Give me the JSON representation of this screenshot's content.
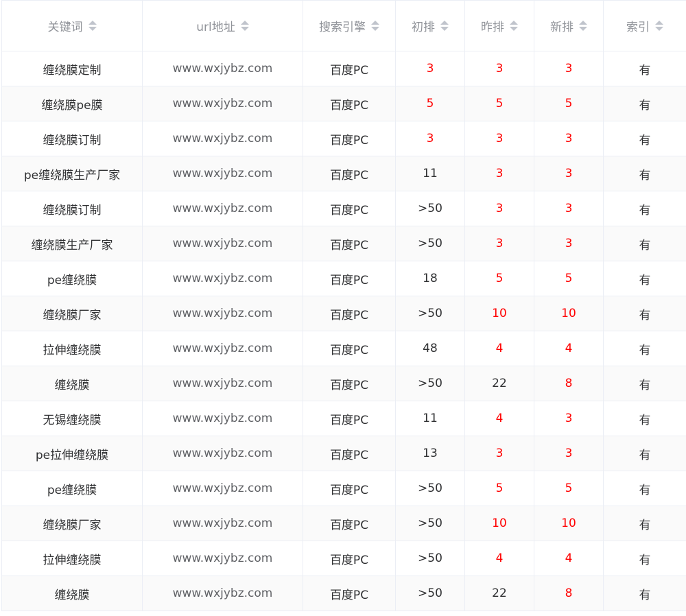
{
  "colors": {
    "rank_highlight": "#ff0000",
    "text": "#303133",
    "header_text": "#909399",
    "border": "#ebeef5",
    "stripe": "#fafafa"
  },
  "columns": [
    {
      "label": "关键词",
      "sort_icon": "sort-caret-icon"
    },
    {
      "label": "url地址",
      "sort_icon": "sort-caret-icon"
    },
    {
      "label": "搜索引擎",
      "sort_icon": "sort-caret-icon"
    },
    {
      "label": "初排",
      "sort_icon": "sort-caret-icon"
    },
    {
      "label": "昨排",
      "sort_icon": "sort-caret-icon"
    },
    {
      "label": "新排",
      "sort_icon": "sort-caret-icon"
    },
    {
      "label": "索引",
      "sort_icon": "sort-caret-icon"
    }
  ],
  "rows": [
    {
      "keyword": "缠绕膜定制",
      "url": "www.wxjybz.com",
      "engine": "百度PC",
      "initial": "3",
      "yesterday": "3",
      "current": "3",
      "index": "有",
      "hi": [
        true,
        true,
        true
      ]
    },
    {
      "keyword": "缠绕膜pe膜",
      "url": "www.wxjybz.com",
      "engine": "百度PC",
      "initial": "5",
      "yesterday": "5",
      "current": "5",
      "index": "有",
      "hi": [
        true,
        true,
        true
      ]
    },
    {
      "keyword": "缠绕膜订制",
      "url": "www.wxjybz.com",
      "engine": "百度PC",
      "initial": "3",
      "yesterday": "3",
      "current": "3",
      "index": "有",
      "hi": [
        true,
        true,
        true
      ]
    },
    {
      "keyword": "pe缠绕膜生产厂家",
      "url": "www.wxjybz.com",
      "engine": "百度PC",
      "initial": "11",
      "yesterday": "3",
      "current": "3",
      "index": "有",
      "hi": [
        false,
        true,
        true
      ]
    },
    {
      "keyword": "缠绕膜订制",
      "url": "www.wxjybz.com",
      "engine": "百度PC",
      "initial": ">50",
      "yesterday": "3",
      "current": "3",
      "index": "有",
      "hi": [
        false,
        true,
        true
      ]
    },
    {
      "keyword": "缠绕膜生产厂家",
      "url": "www.wxjybz.com",
      "engine": "百度PC",
      "initial": ">50",
      "yesterday": "3",
      "current": "3",
      "index": "有",
      "hi": [
        false,
        true,
        true
      ]
    },
    {
      "keyword": "pe缠绕膜",
      "url": "www.wxjybz.com",
      "engine": "百度PC",
      "initial": "18",
      "yesterday": "5",
      "current": "5",
      "index": "有",
      "hi": [
        false,
        true,
        true
      ]
    },
    {
      "keyword": "缠绕膜厂家",
      "url": "www.wxjybz.com",
      "engine": "百度PC",
      "initial": ">50",
      "yesterday": "10",
      "current": "10",
      "index": "有",
      "hi": [
        false,
        true,
        true
      ]
    },
    {
      "keyword": "拉伸缠绕膜",
      "url": "www.wxjybz.com",
      "engine": "百度PC",
      "initial": "48",
      "yesterday": "4",
      "current": "4",
      "index": "有",
      "hi": [
        false,
        true,
        true
      ]
    },
    {
      "keyword": "缠绕膜",
      "url": "www.wxjybz.com",
      "engine": "百度PC",
      "initial": ">50",
      "yesterday": "22",
      "current": "8",
      "index": "有",
      "hi": [
        false,
        false,
        true
      ]
    },
    {
      "keyword": "无锡缠绕膜",
      "url": "www.wxjybz.com",
      "engine": "百度PC",
      "initial": "11",
      "yesterday": "4",
      "current": "3",
      "index": "有",
      "hi": [
        false,
        true,
        true
      ]
    },
    {
      "keyword": "pe拉伸缠绕膜",
      "url": "www.wxjybz.com",
      "engine": "百度PC",
      "initial": "13",
      "yesterday": "3",
      "current": "3",
      "index": "有",
      "hi": [
        false,
        true,
        true
      ]
    },
    {
      "keyword": "pe缠绕膜",
      "url": "www.wxjybz.com",
      "engine": "百度PC",
      "initial": ">50",
      "yesterday": "5",
      "current": "5",
      "index": "有",
      "hi": [
        false,
        true,
        true
      ]
    },
    {
      "keyword": "缠绕膜厂家",
      "url": "www.wxjybz.com",
      "engine": "百度PC",
      "initial": ">50",
      "yesterday": "10",
      "current": "10",
      "index": "有",
      "hi": [
        false,
        true,
        true
      ]
    },
    {
      "keyword": "拉伸缠绕膜",
      "url": "www.wxjybz.com",
      "engine": "百度PC",
      "initial": ">50",
      "yesterday": "4",
      "current": "4",
      "index": "有",
      "hi": [
        false,
        true,
        true
      ]
    },
    {
      "keyword": "缠绕膜",
      "url": "www.wxjybz.com",
      "engine": "百度PC",
      "initial": ">50",
      "yesterday": "22",
      "current": "8",
      "index": "有",
      "hi": [
        false,
        false,
        true
      ]
    }
  ]
}
